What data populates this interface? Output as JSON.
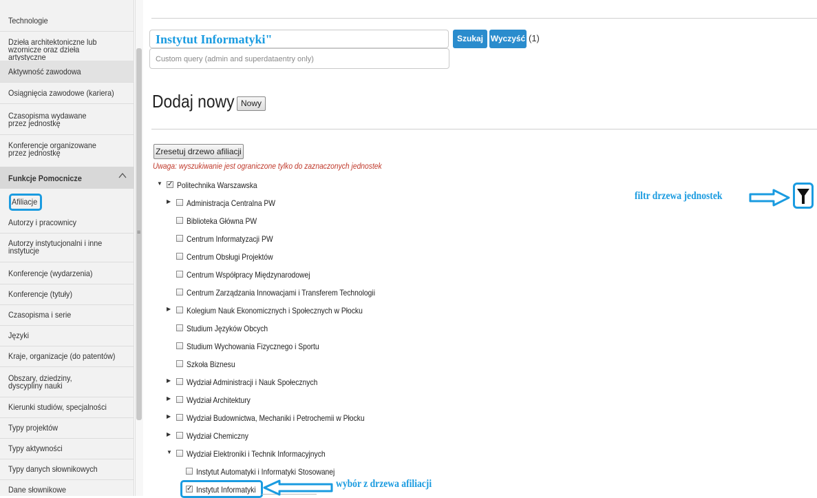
{
  "sidebar": {
    "items": [
      {
        "label": "Technologie"
      },
      {
        "label": "Dzieła architektoniczne lub wzornicze oraz dzieła artystyczne"
      },
      {
        "label": "Aktywność zawodowa"
      },
      {
        "label": "Osiągnięcia zawodowe (kariera)"
      },
      {
        "label": "Czasopisma wydawane przez jednostkę"
      },
      {
        "label": "Konferencje organizowane przez jednostkę"
      }
    ],
    "section_header": "Funkcje Pomocnicze",
    "section_items": [
      {
        "label": "Afiliacje"
      },
      {
        "label": "Autorzy i pracownicy"
      },
      {
        "label": "Autorzy instytucjonalni i inne instytucje"
      },
      {
        "label": "Konferencje (wydarzenia)"
      },
      {
        "label": "Konferencje (tytuły)"
      },
      {
        "label": "Czasopisma i serie"
      },
      {
        "label": "Języki"
      },
      {
        "label": "Kraje, organizacje (do patentów)"
      },
      {
        "label": "Obszary, dziedziny, dyscypliny nauki"
      },
      {
        "label": "Kierunki studiów, specjalności"
      },
      {
        "label": "Typy projektów"
      },
      {
        "label": "Typy aktywności"
      },
      {
        "label": "Typy danych słownikowych"
      },
      {
        "label": "Dane słownikowe"
      }
    ]
  },
  "search": {
    "value": "Instytut Informatyki\"",
    "search_label": "Szukaj",
    "clear_label": "Wyczyść",
    "count": "(1)",
    "custom_query_placeholder": "Custom query (admin and superdataentry only)"
  },
  "add_new": {
    "title": "Dodaj nowy",
    "button_label": "Nowy"
  },
  "tree": {
    "reset_label": "Zresetuj drzewo afiliacji",
    "warning": "Uwaga: wyszukiwanie jest ograniczone tylko do zaznaczonych jednostek",
    "root": "Politechnika Warszawska",
    "children": [
      {
        "label": "Administracja Centralna PW"
      },
      {
        "label": "Biblioteka Główna PW"
      },
      {
        "label": "Centrum Informatyzacji PW"
      },
      {
        "label": "Centrum Obsługi Projektów"
      },
      {
        "label": "Centrum Współpracy Międzynarodowej"
      },
      {
        "label": "Centrum Zarządzania Innowacjami i Transferem Technologii"
      },
      {
        "label": "Kolegium Nauk Ekonomicznych i Społecznych w Płocku"
      },
      {
        "label": "Studium Języków Obcych"
      },
      {
        "label": "Studium Wychowania Fizycznego i Sportu"
      },
      {
        "label": "Szkoła Biznesu"
      },
      {
        "label": "Wydział Administracji i Nauk Społecznych"
      },
      {
        "label": "Wydział Architektury"
      },
      {
        "label": "Wydział Budownictwa, Mechaniki i Petrochemii w Płocku"
      },
      {
        "label": "Wydział Chemiczny"
      },
      {
        "label": "Wydział Elektroniki i Technik Informacyjnych"
      }
    ],
    "grandchildren": [
      {
        "label": "Instytut Automatyki i Informatyki Stosowanej"
      },
      {
        "label": "Instytut Informatyki"
      }
    ]
  },
  "annotations": {
    "filter_label": "filtr drzewa jednostek",
    "selection_label": "wybór z drzewa afiliacji",
    "accent_color": "#1a9be0"
  },
  "icons": [
    "chevron-up-icon",
    "filter-funnel-icon",
    "arrow-right-icon",
    "arrow-left-icon",
    "tree-expand-icon",
    "tree-collapse-icon",
    "checkbox-icon"
  ]
}
